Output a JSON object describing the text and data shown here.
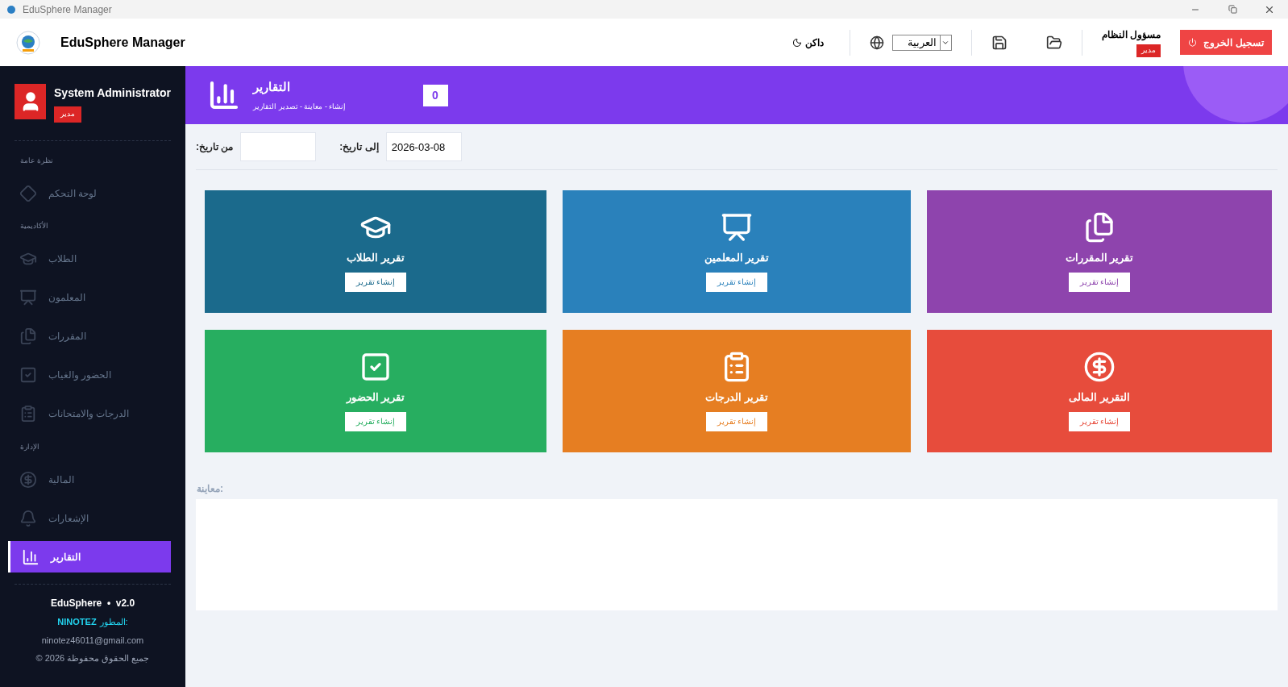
{
  "window": {
    "title": "EduSphere Manager"
  },
  "header": {
    "app_name": "EduSphere Manager",
    "theme_toggle": "داكن",
    "language": "العربية",
    "user_name": "مسؤول النظام",
    "user_role": "مدير",
    "logout": "تسجيل الخروج"
  },
  "sidebar": {
    "user": {
      "name": "System Administrator",
      "role": "مدير"
    },
    "sections": [
      {
        "title": "نظرة عامة",
        "items": [
          {
            "label": "لوحة التحكم",
            "selected": false
          }
        ]
      },
      {
        "title": "الأكاديمية",
        "items": [
          {
            "label": "الطلاب",
            "selected": false
          },
          {
            "label": "المعلمون",
            "selected": false
          },
          {
            "label": "المقررات",
            "selected": false
          },
          {
            "label": "الحضور والغياب",
            "selected": false
          },
          {
            "label": "الدرجات والامتحانات",
            "selected": false
          }
        ]
      },
      {
        "title": "الإدارة",
        "items": [
          {
            "label": "المالية",
            "selected": false
          },
          {
            "label": "الإشعارات",
            "selected": false
          },
          {
            "label": "التقارير",
            "selected": true
          }
        ]
      }
    ],
    "footer": {
      "version": "EduSphere  •  v2.0",
      "developer_label": "المطور:",
      "developer": "NINOTEZ",
      "email": "ninotez46011@gmail.com",
      "copyright": "جميع الحقوق محفوظة 2026 ©"
    }
  },
  "banner": {
    "title": "التقارير",
    "subtitle": "إنشاء - معاينة - تصدير التقارير",
    "count": "0"
  },
  "filters": {
    "to_label": ":إلى تاريخ",
    "to_value": "2026-03-08",
    "from_label": ":من تاريخ"
  },
  "cards": [
    {
      "title": "تقرير المقررات",
      "button": "إنشاء تقرير",
      "color": "#8e44ad"
    },
    {
      "title": "تقرير المعلمين",
      "button": "إنشاء تقرير",
      "color": "#2a81bb"
    },
    {
      "title": "تقرير الطلاب",
      "button": "إنشاء تقرير",
      "color": "#1b6a8c"
    },
    {
      "title": "التقرير المالى",
      "button": "إنشاء تقرير",
      "color": "#e74c3c"
    },
    {
      "title": "تقرير الدرجات",
      "button": "إنشاء تقرير",
      "color": "#e67e22"
    },
    {
      "title": "تقرير الحضور",
      "button": "إنشاء تقرير",
      "color": "#27ae60"
    }
  ],
  "preview": {
    "label": "معاينة:"
  }
}
